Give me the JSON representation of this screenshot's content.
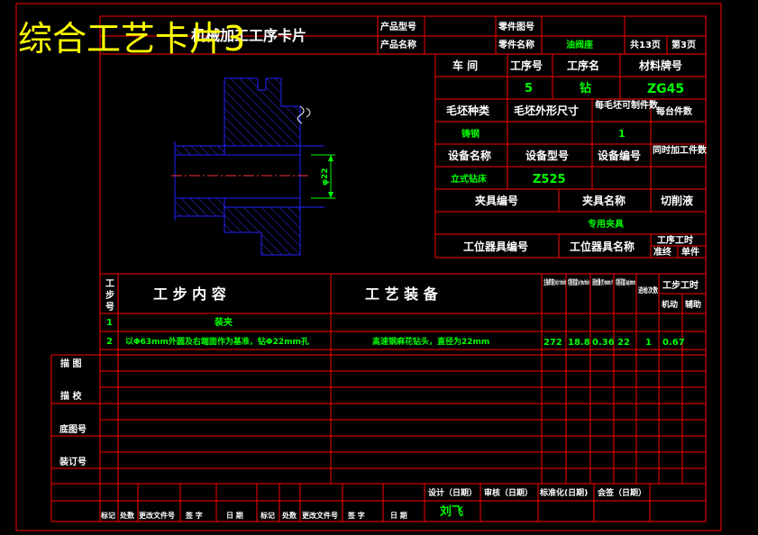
{
  "overlay_title": "综合工艺卡片3",
  "card_title": "机械加工工序卡片",
  "header": {
    "product_model_label": "产品型号",
    "product_name_label": "产品名称",
    "part_drawing_label": "零件图号",
    "part_name_label": "零件名称",
    "part_name": "油阀座",
    "total_pages": "共13页",
    "page_no": "第3页"
  },
  "info": {
    "workshop_label": "车 间",
    "op_no_label": "工序号",
    "op_name_label": "工序名",
    "material_label": "材料牌号",
    "op_no": "5",
    "op_name": "钻",
    "material": "ZG45",
    "blank_type_label": "毛坯种类",
    "blank_size_label": "毛坯外形尺寸",
    "per_blank_label": "每毛坯可制件数",
    "per_unit_label": "每台件数",
    "blank_type": "铸钢",
    "per_blank": "1",
    "equip_name_label": "设备名称",
    "equip_model_label": "设备型号",
    "equip_no_label": "设备编号",
    "simul_label": "同时加工件数",
    "equip_name": "立式钻床",
    "equip_model": "Z525",
    "fixture_no_label": "夹具编号",
    "fixture_name_label": "夹具名称",
    "coolant_label": "切削液",
    "fixture_name": "专用夹具",
    "station_no_label": "工位器具编号",
    "station_name_label": "工位器具名称",
    "op_time_label": "工序工时",
    "prep_label": "准终",
    "unit_label": "单件"
  },
  "drawing": {
    "dimension": "φ22"
  },
  "steps_header": {
    "step_no": "工步号",
    "content": "工 步 内 容",
    "equipment": "工 艺 装 备",
    "spindle": "主轴转速(n)r/min",
    "speed": "切削速度(v)m/min",
    "feed": "进给量(f)mm/r",
    "depth": "切削深度(ap)mm",
    "passes": "进给次数",
    "time": "工步工时",
    "machine": "机动",
    "aux": "辅助"
  },
  "steps": [
    {
      "no": "1",
      "content": "装夹",
      "equipment": "",
      "n": "",
      "v": "",
      "f": "",
      "ap": "",
      "passes": "",
      "tm": "",
      "ta": ""
    },
    {
      "no": "2",
      "content": "以Φ63mm外圆及右端面作为基准，钻Φ22mm孔",
      "equipment": "高速钢麻花钻头，直径为22mm",
      "n": "272",
      "v": "18.8",
      "f": "0.36",
      "ap": "22",
      "passes": "1",
      "tm": "0.67",
      "ta": ""
    }
  ],
  "side_labels": [
    "描 图",
    "描 校",
    "底图号",
    "装订号"
  ],
  "footer": {
    "design": "设计（日期）",
    "review": "审核（日期）",
    "standard": "标准化(日期)",
    "countersign": "会签（日期）",
    "designer": "刘飞",
    "rev_cols": [
      "标记",
      "处数",
      "更改文件号",
      "签 字",
      "日 期",
      "标记",
      "处数",
      "更改文件号",
      "签 字",
      "日 期"
    ]
  }
}
